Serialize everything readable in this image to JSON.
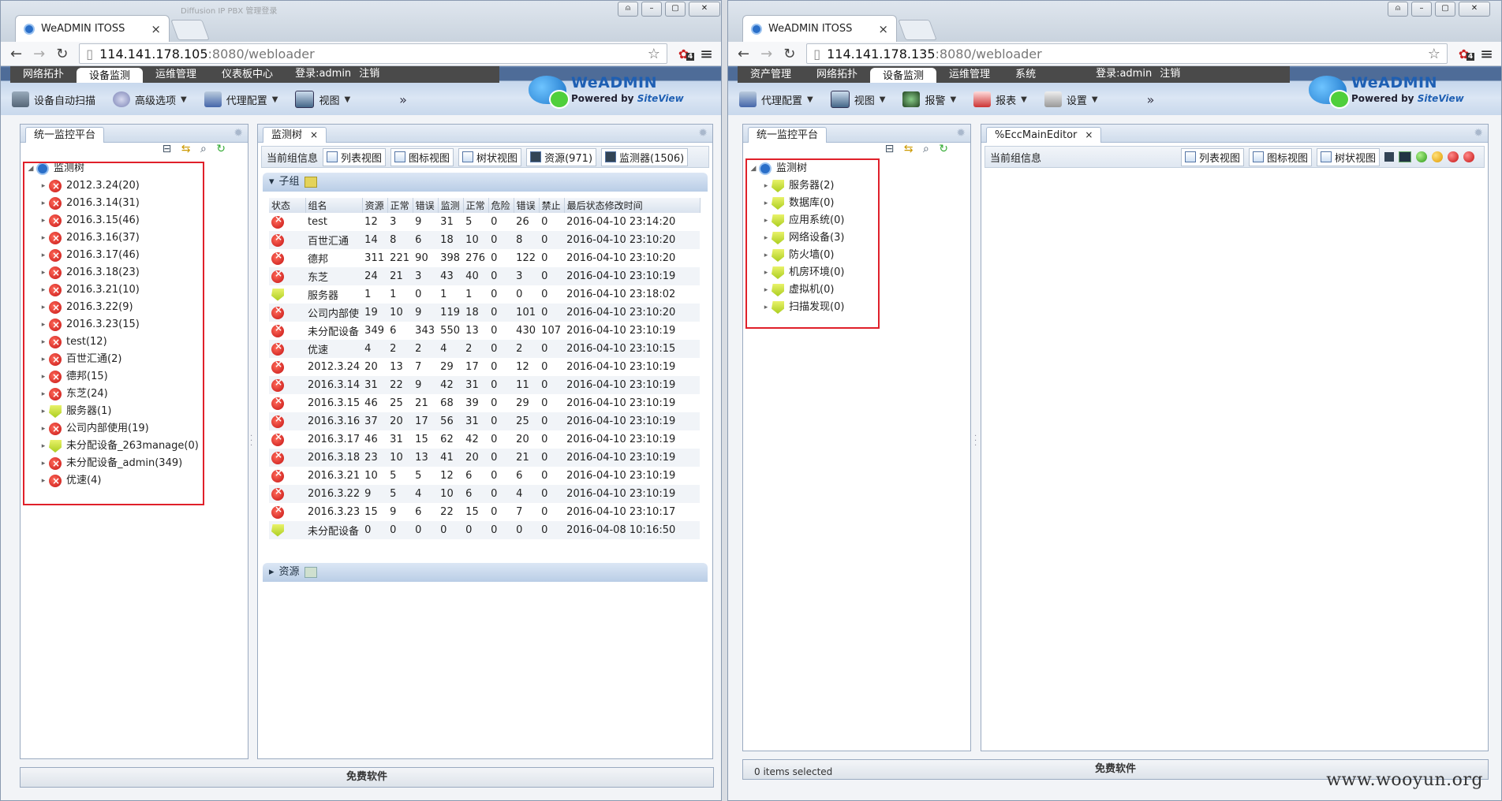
{
  "left": {
    "tab_title": "WeADMIN ITOSS",
    "ghost_tab": "Diffusion IP PBX 管理登录",
    "url_host": "114.141.178.105",
    "url_path": ":8080/webloader",
    "ext_badge": "4",
    "nav_tabs": [
      "网络拓扑",
      "设备监测",
      "运维管理",
      "仪表板中心"
    ],
    "login_text": "登录:admin",
    "logout": "注销",
    "toolbar": [
      "设备自动扫描",
      "高级选项",
      "代理配置",
      "视图"
    ],
    "brand": "WeADMIN",
    "powered_by": "Powered by",
    "powered_brand": "SiteView",
    "tree_panel_title": "统一监控平台",
    "tree": [
      {
        "label": "监测树",
        "icon": "root"
      },
      {
        "label": "2012.3.24(20)",
        "icon": "err"
      },
      {
        "label": "2016.3.14(31)",
        "icon": "err"
      },
      {
        "label": "2016.3.15(46)",
        "icon": "err"
      },
      {
        "label": "2016.3.16(37)",
        "icon": "err"
      },
      {
        "label": "2016.3.17(46)",
        "icon": "err"
      },
      {
        "label": "2016.3.18(23)",
        "icon": "err"
      },
      {
        "label": "2016.3.21(10)",
        "icon": "err"
      },
      {
        "label": "2016.3.22(9)",
        "icon": "err"
      },
      {
        "label": "2016.3.23(15)",
        "icon": "err"
      },
      {
        "label": "test(12)",
        "icon": "err"
      },
      {
        "label": "百世汇通(2)",
        "icon": "err"
      },
      {
        "label": "德邦(15)",
        "icon": "err"
      },
      {
        "label": "东芝(24)",
        "icon": "err"
      },
      {
        "label": "服务器(1)",
        "icon": "ok"
      },
      {
        "label": "公司内部使用(19)",
        "icon": "err"
      },
      {
        "label": "未分配设备_263manage(0)",
        "icon": "ok"
      },
      {
        "label": "未分配设备_admin(349)",
        "icon": "err"
      },
      {
        "label": "优速(4)",
        "icon": "err"
      }
    ],
    "main_panel_title": "监测树",
    "info_label": "当前组信息",
    "view_buttons": [
      "列表视图",
      "图标视图",
      "树状视图",
      "资源(971)",
      "监测器(1506)"
    ],
    "section_subgroup": "子组",
    "section_resource": "资源",
    "table": {
      "headers": [
        "状态",
        "组名",
        "资源",
        "正常",
        "错误",
        "监测",
        "正常",
        "危险",
        "错误",
        "禁止",
        "最后状态修改时间"
      ],
      "rows": [
        [
          "err",
          "test",
          "12",
          "3",
          "9",
          "31",
          "5",
          "0",
          "26",
          "0",
          "2016-04-10 23:14:20"
        ],
        [
          "err",
          "百世汇通",
          "14",
          "8",
          "6",
          "18",
          "10",
          "0",
          "8",
          "0",
          "2016-04-10 23:10:20"
        ],
        [
          "err",
          "德邦",
          "311",
          "221",
          "90",
          "398",
          "276",
          "0",
          "122",
          "0",
          "2016-04-10 23:10:20"
        ],
        [
          "err",
          "东芝",
          "24",
          "21",
          "3",
          "43",
          "40",
          "0",
          "3",
          "0",
          "2016-04-10 23:10:19"
        ],
        [
          "ok",
          "服务器",
          "1",
          "1",
          "0",
          "1",
          "1",
          "0",
          "0",
          "0",
          "2016-04-10 23:18:02"
        ],
        [
          "err",
          "公司内部使",
          "19",
          "10",
          "9",
          "119",
          "18",
          "0",
          "101",
          "0",
          "2016-04-10 23:10:20"
        ],
        [
          "err",
          "未分配设备",
          "349",
          "6",
          "343",
          "550",
          "13",
          "0",
          "430",
          "107",
          "2016-04-10 23:10:19"
        ],
        [
          "err",
          "优速",
          "4",
          "2",
          "2",
          "4",
          "2",
          "0",
          "2",
          "0",
          "2016-04-10 23:10:15"
        ],
        [
          "err",
          "2012.3.24",
          "20",
          "13",
          "7",
          "29",
          "17",
          "0",
          "12",
          "0",
          "2016-04-10 23:10:19"
        ],
        [
          "err",
          "2016.3.14",
          "31",
          "22",
          "9",
          "42",
          "31",
          "0",
          "11",
          "0",
          "2016-04-10 23:10:19"
        ],
        [
          "err",
          "2016.3.15",
          "46",
          "25",
          "21",
          "68",
          "39",
          "0",
          "29",
          "0",
          "2016-04-10 23:10:19"
        ],
        [
          "err",
          "2016.3.16",
          "37",
          "20",
          "17",
          "56",
          "31",
          "0",
          "25",
          "0",
          "2016-04-10 23:10:19"
        ],
        [
          "err",
          "2016.3.17",
          "46",
          "31",
          "15",
          "62",
          "42",
          "0",
          "20",
          "0",
          "2016-04-10 23:10:19"
        ],
        [
          "err",
          "2016.3.18",
          "23",
          "10",
          "13",
          "41",
          "20",
          "0",
          "21",
          "0",
          "2016-04-10 23:10:19"
        ],
        [
          "err",
          "2016.3.21",
          "10",
          "5",
          "5",
          "12",
          "6",
          "0",
          "6",
          "0",
          "2016-04-10 23:10:19"
        ],
        [
          "err",
          "2016.3.22",
          "9",
          "5",
          "4",
          "10",
          "6",
          "0",
          "4",
          "0",
          "2016-04-10 23:10:19"
        ],
        [
          "err",
          "2016.3.23",
          "15",
          "9",
          "6",
          "22",
          "15",
          "0",
          "7",
          "0",
          "2016-04-10 23:10:17"
        ],
        [
          "ok",
          "未分配设备",
          "0",
          "0",
          "0",
          "0",
          "0",
          "0",
          "0",
          "0",
          "2016-04-08 10:16:50"
        ]
      ]
    },
    "footer": "免费软件"
  },
  "right": {
    "tab_title": "WeADMIN ITOSS",
    "url_host": "114.141.178.135",
    "url_path": ":8080/webloader",
    "ext_badge": "4",
    "nav_tabs": [
      "资产管理",
      "网络拓扑",
      "设备监测",
      "运维管理",
      "系统"
    ],
    "login_text": "登录:admin",
    "logout": "注销",
    "toolbar": [
      "代理配置",
      "视图",
      "报警",
      "报表",
      "设置"
    ],
    "brand": "WeADMIN",
    "powered_by": "Powered by",
    "powered_brand": "SiteView",
    "tree_panel_title": "统一监控平台",
    "tree": [
      {
        "label": "监测树",
        "icon": "root"
      },
      {
        "label": "服务器(2)",
        "icon": "ok"
      },
      {
        "label": "数据库(0)",
        "icon": "ok"
      },
      {
        "label": "应用系统(0)",
        "icon": "ok"
      },
      {
        "label": "网络设备(3)",
        "icon": "ok"
      },
      {
        "label": "防火墙(0)",
        "icon": "ok"
      },
      {
        "label": "机房环境(0)",
        "icon": "ok"
      },
      {
        "label": "虚拟机(0)",
        "icon": "ok"
      },
      {
        "label": "扫描发现(0)",
        "icon": "ok"
      }
    ],
    "main_panel_title": "%EccMainEditor",
    "info_label": "当前组信息",
    "view_buttons": [
      "列表视图",
      "图标视图",
      "树状视图"
    ],
    "status_text": "0 items selected",
    "footer": "免费软件"
  },
  "watermark": "www.wooyun.org"
}
